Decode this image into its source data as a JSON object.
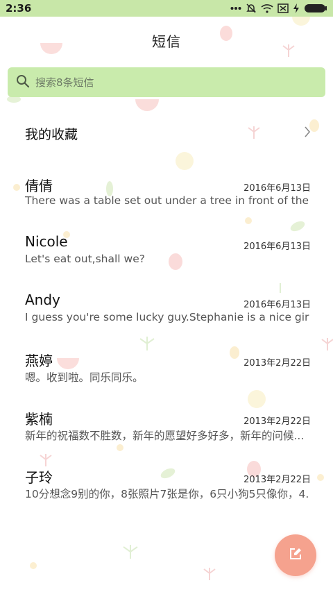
{
  "status_bar": {
    "time": "2:36"
  },
  "header": {
    "title": "短信"
  },
  "search": {
    "placeholder": "搜索8条短信"
  },
  "favorites": {
    "label": "我的收藏"
  },
  "conversations": [
    {
      "name": "倩倩",
      "date": "2016年6月13日",
      "preview": "There was a table set out under a tree in front of the h..."
    },
    {
      "name": "Nicole",
      "date": "2016年6月13日",
      "preview": "Let's eat out,shall we?"
    },
    {
      "name": "Andy",
      "date": "2016年6月13日",
      "preview": "I guess you're some lucky guy.Stephanie is a nice girl."
    },
    {
      "name": "燕婷",
      "date": "2013年2月22日",
      "preview": "嗯。收到啦。同乐同乐。"
    },
    {
      "name": "紫楠",
      "date": "2013年2月22日",
      "preview": "新年的祝福数不胜数，新年的愿望好多好多，新年的问候..."
    },
    {
      "name": "子玲",
      "date": "2013年2月22日",
      "preview": "10分想念9别的你，8张照片7张是你，6只小狗5只像你，4..."
    }
  ],
  "colors": {
    "status_bar": "#c8e7a8",
    "search_bg": "#c9ebac",
    "fab": "#f5a28e"
  },
  "icons": {
    "search": "search-icon",
    "chevron": "chevron-right-icon",
    "compose": "compose-icon",
    "signal_dots": "signal-dots-icon",
    "mute": "mute-icon",
    "wifi": "wifi-icon",
    "sim": "no-sim-icon",
    "charging": "charging-icon",
    "battery": "battery-icon"
  }
}
